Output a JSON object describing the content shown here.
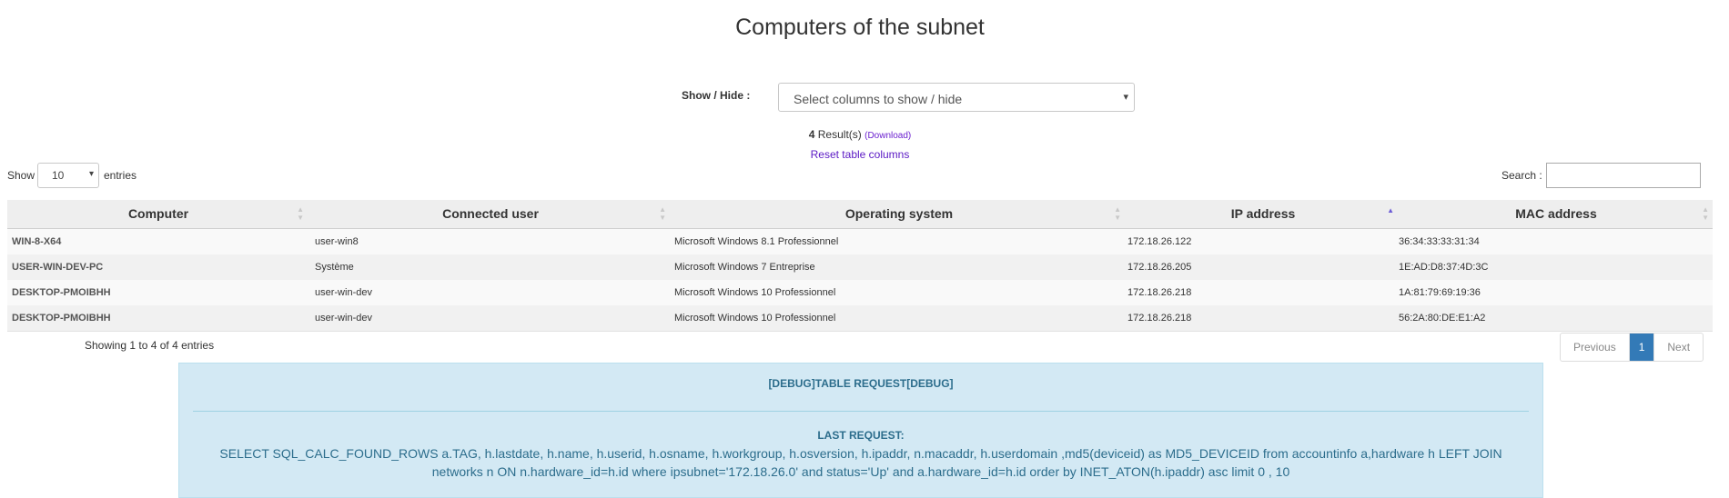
{
  "page_title": "Computers of the subnet",
  "show_hide": {
    "label": "Show / Hide :",
    "placeholder": "Select columns to show / hide"
  },
  "results": {
    "count": "4",
    "label": "Result(s)",
    "download_label": "(Download)"
  },
  "reset_label": "Reset table columns",
  "length": {
    "show_label": "Show",
    "value": "10",
    "entries_label": "entries"
  },
  "search": {
    "label": "Search :",
    "value": ""
  },
  "table": {
    "columns": [
      "Computer",
      "Connected user",
      "Operating system",
      "IP address",
      "MAC address"
    ],
    "sorted_column": "IP address",
    "sort_direction": "asc",
    "rows": [
      [
        "WIN-8-X64",
        "user-win8",
        "Microsoft Windows 8.1 Professionnel",
        "172.18.26.122",
        "36:34:33:33:31:34"
      ],
      [
        "USER-WIN-DEV-PC",
        "Système",
        "Microsoft Windows 7 Entreprise",
        "172.18.26.205",
        "1E:AD:D8:37:4D:3C"
      ],
      [
        "DESKTOP-PMOIBHH",
        "user-win-dev",
        "Microsoft Windows 10 Professionnel",
        "172.18.26.218",
        "1A:81:79:69:19:36"
      ],
      [
        "DESKTOP-PMOIBHH",
        "user-win-dev",
        "Microsoft Windows 10 Professionnel",
        "172.18.26.218",
        "56:2A:80:DE:E1:A2"
      ]
    ]
  },
  "info": "Showing 1 to 4 of 4 entries",
  "pagination": {
    "previous": "Previous",
    "current": "1",
    "next": "Next"
  },
  "debug": {
    "title": "[DEBUG]TABLE REQUEST[DEBUG]",
    "label": "LAST REQUEST:",
    "query": "SELECT SQL_CALC_FOUND_ROWS a.TAG, h.lastdate, h.name, h.userid, h.osname, h.workgroup, h.osversion, h.ipaddr, n.macaddr, h.userdomain ,md5(deviceid) as MD5_DEVICEID from accountinfo a,hardware h LEFT JOIN networks n ON n.hardware_id=h.id where ipsubnet='172.18.26.0' and status='Up' and a.hardware_id=h.id order by INET_ATON(h.ipaddr) asc limit 0 , 10"
  },
  "colors": {
    "accent": "#337ab7",
    "link": "#5a18c4",
    "debug_bg": "#d3e9f4",
    "debug_text": "#2c6d8c"
  }
}
